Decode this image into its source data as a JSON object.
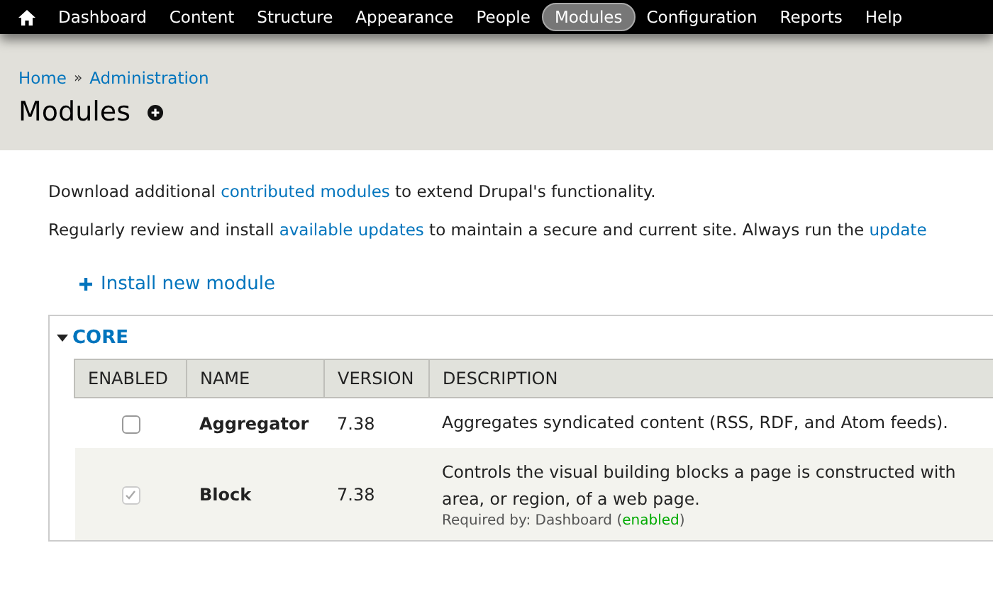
{
  "toolbar": {
    "items": [
      {
        "label": "Dashboard",
        "selected": false
      },
      {
        "label": "Content",
        "selected": false
      },
      {
        "label": "Structure",
        "selected": false
      },
      {
        "label": "Appearance",
        "selected": false
      },
      {
        "label": "People",
        "selected": false
      },
      {
        "label": "Modules",
        "selected": true
      },
      {
        "label": "Configuration",
        "selected": false
      },
      {
        "label": "Reports",
        "selected": false
      },
      {
        "label": "Help",
        "selected": false
      }
    ]
  },
  "breadcrumb": {
    "items": [
      "Home",
      "Administration"
    ],
    "separator": "»"
  },
  "page_title": "Modules",
  "intro": [
    {
      "before": "Download additional ",
      "link": "contributed modules",
      "after": " to extend Drupal's functionality."
    },
    {
      "before": "Regularly review and install ",
      "link": "available updates",
      "after": " to maintain a secure and current site. Always run the ",
      "link2": "update"
    }
  ],
  "install_link": "Install new module",
  "fieldset": {
    "legend": "CORE",
    "expanded": true
  },
  "table": {
    "columns": [
      "ENABLED",
      "NAME",
      "VERSION",
      "DESCRIPTION"
    ],
    "rows": [
      {
        "checked": false,
        "disabled": false,
        "name": "Aggregator",
        "version": "7.38",
        "description": [
          "Aggregates syndicated content (RSS, RDF, and Atom feeds)."
        ]
      },
      {
        "checked": true,
        "disabled": true,
        "name": "Block",
        "version": "7.38",
        "description": [
          "Controls the visual building blocks a page is constructed with",
          "area, or region, of a web page."
        ],
        "required_by": {
          "label": "Required by: Dashboard (",
          "status": "enabled",
          "close": ")"
        }
      }
    ]
  }
}
